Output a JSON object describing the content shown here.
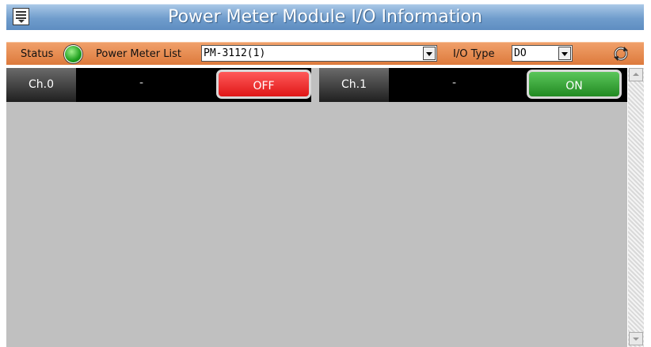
{
  "header": {
    "title": "Power Meter Module I/O Information",
    "menu_icon": "menu-icon"
  },
  "toolbar": {
    "status_label": "Status",
    "status_color": "#22aa22",
    "meter_list_label": "Power Meter List",
    "meter_list_value": "PM-3112(1)",
    "io_type_label": "I/O Type",
    "io_type_value": "DO",
    "refresh_icon": "refresh-icon"
  },
  "channels": [
    {
      "name": "Ch.0",
      "value": "-",
      "state": "OFF",
      "state_color": "#e82020"
    },
    {
      "name": "Ch.1",
      "value": "-",
      "state": "ON",
      "state_color": "#2e9a2e"
    }
  ],
  "colors": {
    "titlebar": "#6f9ccc",
    "toolbar": "#e8874a",
    "content_bg": "#c0c0c0"
  }
}
